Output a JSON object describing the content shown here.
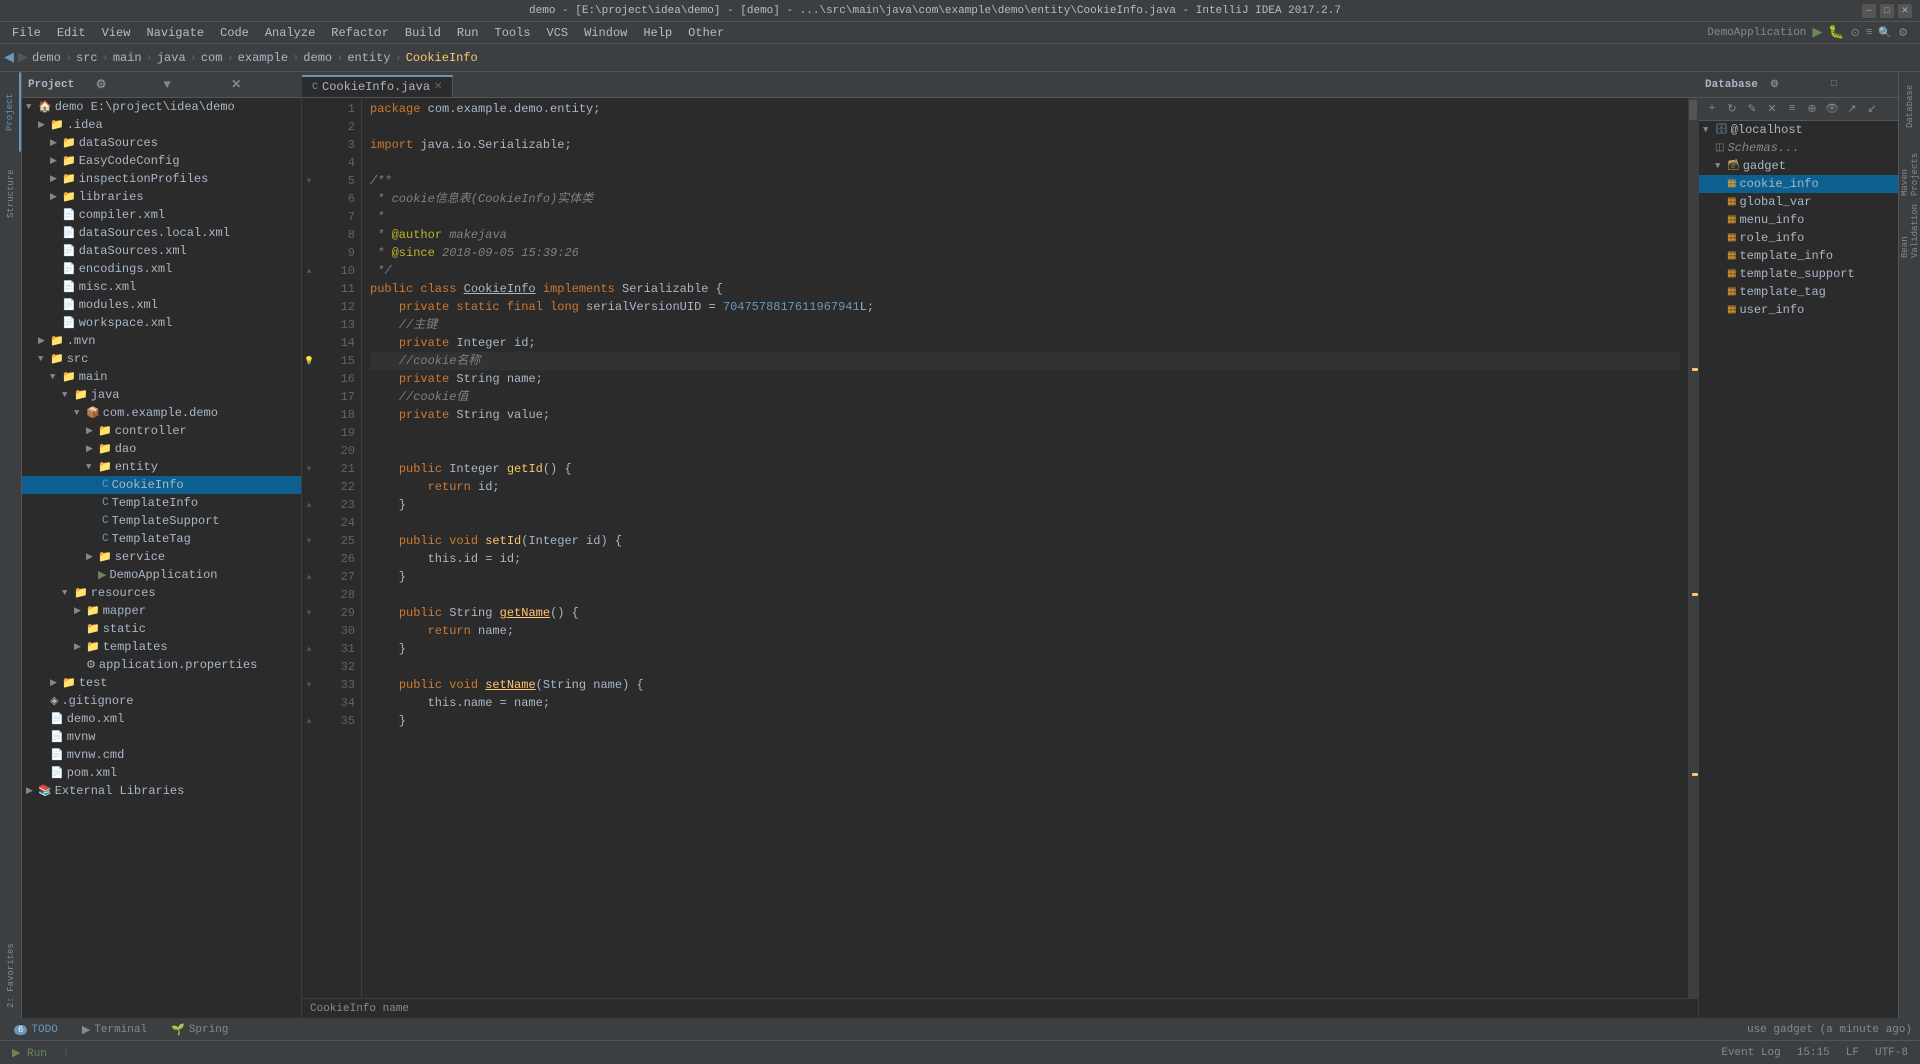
{
  "titlebar": {
    "title": "demo - [E:\\project\\idea\\demo] - [demo] - ...\\src\\main\\java\\com\\example\\demo\\entity\\CookieInfo.java - IntelliJ IDEA 2017.2.7"
  },
  "menubar": {
    "items": [
      "File",
      "Edit",
      "View",
      "Navigate",
      "Code",
      "Analyze",
      "Refactor",
      "Build",
      "Run",
      "Tools",
      "VCS",
      "Window",
      "Help",
      "Other"
    ]
  },
  "navbar": {
    "items": [
      "demo",
      "src",
      "main",
      "java",
      "com",
      "example",
      "demo",
      "entity",
      "CookieInfo"
    ]
  },
  "project_panel": {
    "title": "Project",
    "tree": [
      {
        "id": "demo-root",
        "label": "demo E:\\project\\idea\\demo",
        "type": "project",
        "indent": 0,
        "expanded": true
      },
      {
        "id": "idea",
        "label": ".idea",
        "type": "folder",
        "indent": 1,
        "expanded": false
      },
      {
        "id": "dataSources",
        "label": "dataSources",
        "type": "folder",
        "indent": 2,
        "expanded": false
      },
      {
        "id": "EasyCodeConfig",
        "label": "EasyCodeConfig",
        "type": "folder",
        "indent": 2,
        "expanded": false
      },
      {
        "id": "inspectionProfiles",
        "label": "inspectionProfiles",
        "type": "folder",
        "indent": 2,
        "expanded": false
      },
      {
        "id": "libraries",
        "label": "libraries",
        "type": "folder",
        "indent": 2,
        "expanded": false
      },
      {
        "id": "compiler.xml",
        "label": "compiler.xml",
        "type": "xml",
        "indent": 2
      },
      {
        "id": "dataSources.local.xml",
        "label": "dataSources.local.xml",
        "type": "xml",
        "indent": 2
      },
      {
        "id": "dataSources.xml",
        "label": "dataSources.xml",
        "type": "xml",
        "indent": 2
      },
      {
        "id": "encodings.xml",
        "label": "encodings.xml",
        "type": "xml",
        "indent": 2
      },
      {
        "id": "misc.xml",
        "label": "misc.xml",
        "type": "xml",
        "indent": 2
      },
      {
        "id": "modules.xml",
        "label": "modules.xml",
        "type": "xml",
        "indent": 2
      },
      {
        "id": "workspace.xml",
        "label": "workspace.xml",
        "type": "xml",
        "indent": 2
      },
      {
        "id": "mvn",
        "label": ".mvn",
        "type": "folder",
        "indent": 1,
        "expanded": false
      },
      {
        "id": "src",
        "label": "src",
        "type": "folder",
        "indent": 1,
        "expanded": true
      },
      {
        "id": "main",
        "label": "main",
        "type": "folder",
        "indent": 2,
        "expanded": true
      },
      {
        "id": "java",
        "label": "java",
        "type": "folder-src",
        "indent": 3,
        "expanded": true
      },
      {
        "id": "com.example.demo",
        "label": "com.example.demo",
        "type": "package",
        "indent": 4,
        "expanded": true
      },
      {
        "id": "controller",
        "label": "controller",
        "type": "folder",
        "indent": 5,
        "expanded": false
      },
      {
        "id": "dao",
        "label": "dao",
        "type": "folder",
        "indent": 5,
        "expanded": false
      },
      {
        "id": "entity",
        "label": "entity",
        "type": "folder",
        "indent": 5,
        "expanded": true
      },
      {
        "id": "CookieInfo",
        "label": "CookieInfo",
        "type": "java-class",
        "indent": 6,
        "selected": true
      },
      {
        "id": "TemplateInfo",
        "label": "TemplateInfo",
        "type": "java-class",
        "indent": 6
      },
      {
        "id": "TemplateSupport",
        "label": "TemplateSupport",
        "type": "java-class",
        "indent": 6
      },
      {
        "id": "TemplateTag",
        "label": "TemplateTag",
        "type": "java-class",
        "indent": 6
      },
      {
        "id": "service",
        "label": "service",
        "type": "folder",
        "indent": 5,
        "expanded": false
      },
      {
        "id": "DemoApplication",
        "label": "DemoApplication",
        "type": "java-main",
        "indent": 6
      },
      {
        "id": "resources",
        "label": "resources",
        "type": "folder",
        "indent": 3,
        "expanded": true
      },
      {
        "id": "mapper",
        "label": "mapper",
        "type": "folder",
        "indent": 4,
        "expanded": false
      },
      {
        "id": "static",
        "label": "static",
        "type": "folder",
        "indent": 4
      },
      {
        "id": "templates",
        "label": "templates",
        "type": "folder",
        "indent": 4,
        "expanded": false
      },
      {
        "id": "application.properties",
        "label": "application.properties",
        "type": "properties",
        "indent": 4
      },
      {
        "id": "test",
        "label": "test",
        "type": "folder",
        "indent": 2,
        "expanded": false
      },
      {
        "id": ".gitignore",
        "label": ".gitignore",
        "type": "git",
        "indent": 1
      },
      {
        "id": "demo.xml",
        "label": "demo.xml",
        "type": "xml",
        "indent": 1
      },
      {
        "id": "mvnw",
        "label": "mvnw",
        "type": "file",
        "indent": 1
      },
      {
        "id": "mvnw.cmd",
        "label": "mvnw.cmd",
        "type": "file",
        "indent": 1
      },
      {
        "id": "pom.xml",
        "label": "pom.xml",
        "type": "pom",
        "indent": 1
      },
      {
        "id": "external-libraries",
        "label": "External Libraries",
        "type": "lib",
        "indent": 0,
        "expanded": false
      }
    ]
  },
  "editor": {
    "tab_label": "CookieInfo.java",
    "breadcrumb_bottom": "CookieInfo  name",
    "lines": [
      {
        "num": 1,
        "code": "package com.example.demo.entity;",
        "type": "package"
      },
      {
        "num": 2,
        "code": ""
      },
      {
        "num": 3,
        "code": "import java.io.Serializable;",
        "type": "import"
      },
      {
        "num": 4,
        "code": ""
      },
      {
        "num": 5,
        "code": "/**",
        "type": "comment-start",
        "foldable": true
      },
      {
        "num": 6,
        "code": " * cookie信息表(CookieInfo)实体类",
        "type": "comment"
      },
      {
        "num": 7,
        "code": " *",
        "type": "comment"
      },
      {
        "num": 8,
        "code": " * @author makejava",
        "type": "comment"
      },
      {
        "num": 9,
        "code": " * @since 2018-09-05 15:39:26",
        "type": "comment"
      },
      {
        "num": 10,
        "code": " */",
        "type": "comment-end",
        "foldable": true
      },
      {
        "num": 11,
        "code": "public class CookieInfo implements Serializable {",
        "type": "class"
      },
      {
        "num": 12,
        "code": "    private static final long serialVersionUID = 7047578817611967941L;",
        "type": "field"
      },
      {
        "num": 13,
        "code": "    //主键",
        "type": "comment-inline"
      },
      {
        "num": 14,
        "code": "    private Integer id;",
        "type": "field"
      },
      {
        "num": 15,
        "code": "    //cookie名称",
        "type": "comment-inline",
        "highlighted": true
      },
      {
        "num": 16,
        "code": "    private String name;",
        "type": "field"
      },
      {
        "num": 17,
        "code": "    //cookie值",
        "type": "comment-inline"
      },
      {
        "num": 18,
        "code": "    private String value;",
        "type": "field"
      },
      {
        "num": 19,
        "code": ""
      },
      {
        "num": 20,
        "code": ""
      },
      {
        "num": 21,
        "code": "    public Integer getId() {",
        "type": "method",
        "foldable": true
      },
      {
        "num": 22,
        "code": "        return id;",
        "type": "code"
      },
      {
        "num": 23,
        "code": "    }",
        "type": "code"
      },
      {
        "num": 24,
        "code": ""
      },
      {
        "num": 25,
        "code": "    public void setId(Integer id) {",
        "type": "method",
        "foldable": true
      },
      {
        "num": 26,
        "code": "        this.id = id;",
        "type": "code"
      },
      {
        "num": 27,
        "code": "    }",
        "type": "code"
      },
      {
        "num": 28,
        "code": ""
      },
      {
        "num": 29,
        "code": "    public String getName() {",
        "type": "method",
        "foldable": true
      },
      {
        "num": 30,
        "code": "        return name;",
        "type": "code"
      },
      {
        "num": 31,
        "code": "    }",
        "type": "code"
      },
      {
        "num": 32,
        "code": ""
      },
      {
        "num": 33,
        "code": "    public void setName(String name) {",
        "type": "method",
        "foldable": true
      },
      {
        "num": 34,
        "code": "        this.name = name;",
        "type": "code"
      },
      {
        "num": 35,
        "code": "    }",
        "type": "code"
      }
    ]
  },
  "database_panel": {
    "title": "Database",
    "server": "@localhost",
    "schemas_label": "Schemas...",
    "gadget_label": "gadget",
    "tables": [
      "cookie_info",
      "global_var",
      "menu_info",
      "role_info",
      "template_info",
      "template_support",
      "template_tag",
      "user_info"
    ]
  },
  "statusbar": {
    "todo_count": "6",
    "todo_label": "TODO",
    "terminal_label": "Terminal",
    "spring_label": "Spring",
    "right": {
      "line_col": "15:15",
      "lf": "LF",
      "utf8": "UTF-8",
      "event_log": "Event Log"
    }
  },
  "bottom_notification": {
    "text": "use gadget (a minute ago)"
  },
  "right_tools": [
    "Maven Projects",
    "Bean Validation"
  ],
  "left_tools": [
    "Project",
    "Favorites",
    "Structure",
    "2: Favorites"
  ]
}
